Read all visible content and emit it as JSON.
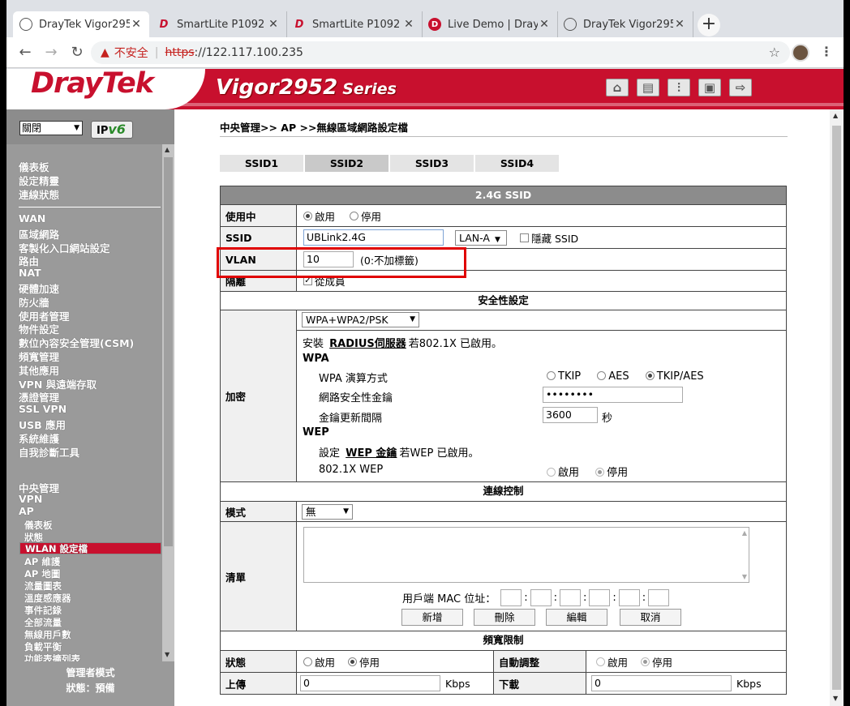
{
  "browser": {
    "tabs": [
      {
        "title": "DrayTek Vigor295",
        "icon": "globe-icon",
        "active": true
      },
      {
        "title": "SmartLite P1092",
        "icon": "draytek-icon"
      },
      {
        "title": "SmartLite P1092",
        "icon": "draytek-icon"
      },
      {
        "title": "Live Demo | DrayT",
        "icon": "live-demo-icon"
      },
      {
        "title": "DrayTek Vigor295",
        "icon": "globe-icon"
      }
    ],
    "security_label": "不安全",
    "url_scheme": "https",
    "url_host": "://122.117.100.235"
  },
  "header": {
    "brand": "DrayTek",
    "model": "Vigor2952",
    "series": "Series"
  },
  "sidebar": {
    "language": "關閉",
    "ipv6_label": "IPv6",
    "group1": [
      "儀表板",
      "設定精靈",
      "連線狀態"
    ],
    "group2": [
      "WAN",
      "區域網路",
      "客製化入口網站設定",
      "路由",
      "NAT",
      "硬體加速",
      "防火牆",
      "使用者管理",
      "物件設定",
      "數位內容安全管理(CSM)",
      "頻寬管理",
      "其他應用",
      "VPN 與遠端存取",
      "憑證管理",
      "SSL VPN",
      "USB 應用",
      "系統維護",
      "自我診斷工具"
    ],
    "group3": [
      "中央管理",
      "VPN",
      "AP"
    ],
    "ap_items": [
      "儀表板",
      "狀態",
      "WLAN 設定檔",
      "AP 維護",
      "AP 地圖",
      "流量圖表",
      "溫度感應器",
      "事件記錄",
      "全部流量",
      "無線用戶數",
      "負載平衡",
      "功能表擴列表"
    ],
    "selected": "WLAN 設定檔",
    "footer_mode": "管理者模式",
    "footer_status": "狀態：預備"
  },
  "main": {
    "breadcrumb": "中央管理>> AP >>無線區域網路設定檔",
    "ssid_tabs": [
      "SSID1",
      "SSID2",
      "SSID3",
      "SSID4"
    ],
    "active_tab": "SSID2",
    "section_title": "2.4G SSID",
    "enable": {
      "label": "使用中",
      "on": "啟用",
      "off": "停用"
    },
    "ssid": {
      "label": "SSID",
      "value": "UBLink2.4G",
      "lan": "LAN-A",
      "hide": "隱藏 SSID"
    },
    "vlan": {
      "label": "VLAN",
      "value": "10",
      "note": "(0:不加標籤)"
    },
    "isolate": {
      "label": "隔離",
      "value": "從成員"
    },
    "security": {
      "title": "安全性設定",
      "label": "加密",
      "mode": "WPA+WPA2/PSK",
      "radius_pre": "安裝",
      "radius_link": "RADIUS伺服器",
      "radius_post": "若802.1X 已啟用。",
      "wpa_title": "WPA",
      "wpa_algo_label": "WPA 演算方式",
      "algo": [
        "TKIP",
        "AES",
        "TKIP/AES"
      ],
      "psk_label": "網路安全性金鑰",
      "psk_value": "••••••••",
      "rekey_label": "金鑰更新間隔",
      "rekey_value": "3600",
      "rekey_unit": "秒",
      "wep_title": "WEP",
      "wep_pre": "設定",
      "wep_link": "WEP 金鑰",
      "wep_post": "若WEP 已啟用。",
      "dot1x_label": "802.1X WEP",
      "dot1x_on": "啟用",
      "dot1x_off": "停用"
    },
    "access": {
      "title": "連線控制",
      "mode_label": "模式",
      "mode_value": "無",
      "list_label": "清單",
      "mac_label": "用戶端 MAC 位址：",
      "buttons": [
        "新增",
        "刪除",
        "編輯",
        "取消"
      ]
    },
    "bandwidth": {
      "title": "頻寬限制",
      "status_label": "狀態",
      "on": "啟用",
      "off": "停用",
      "auto_label": "自動調整",
      "up_label": "上傳",
      "up_value": "0",
      "down_label": "下載",
      "down_value": "0",
      "unit": "Kbps"
    }
  }
}
